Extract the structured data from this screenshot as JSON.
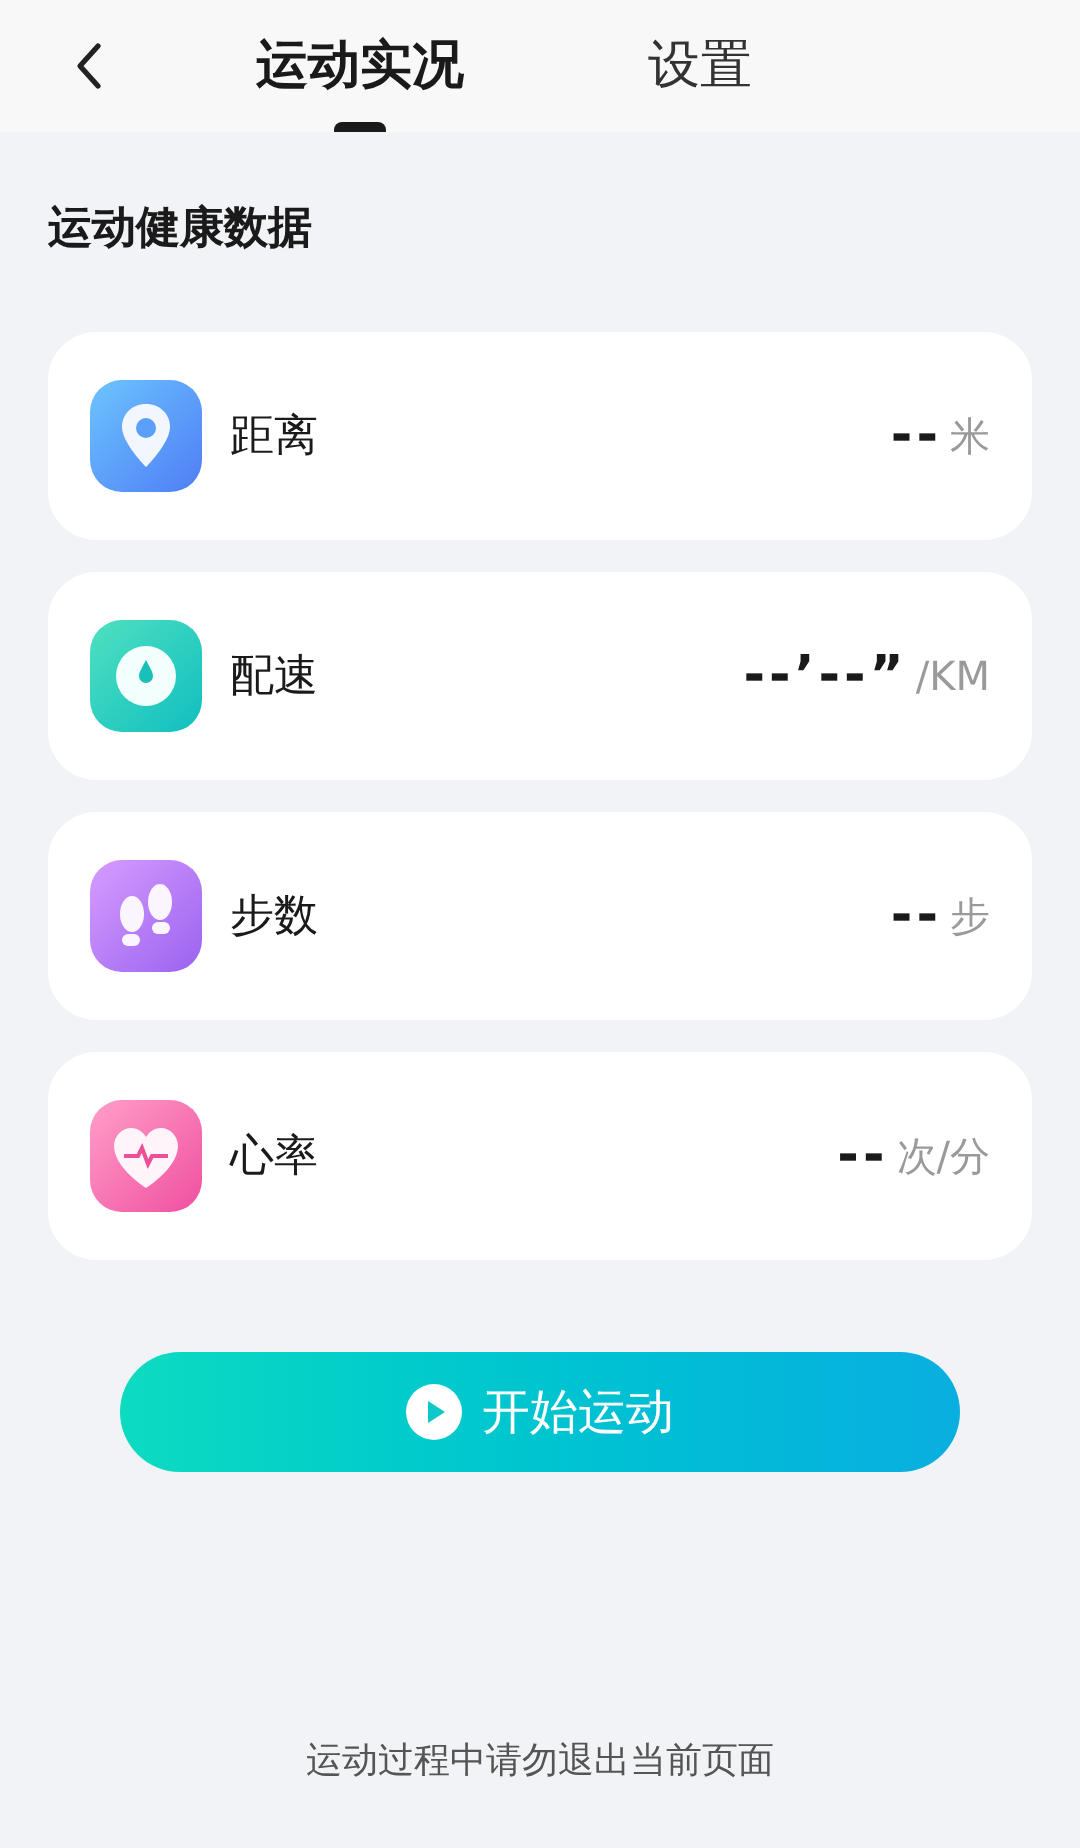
{
  "tabs": [
    {
      "label": "运动实况",
      "selected": true
    },
    {
      "label": "设置",
      "selected": false
    }
  ],
  "section_title": "运动健康数据",
  "metrics": [
    {
      "kind": "distance",
      "label": "距离",
      "value": "--",
      "unit": "米"
    },
    {
      "kind": "pace",
      "label": "配速",
      "value": "--’--”",
      "unit": "/KM"
    },
    {
      "kind": "steps",
      "label": "步数",
      "value": "--",
      "unit": "步"
    },
    {
      "kind": "heart",
      "label": "心率",
      "value": "--",
      "unit": "次/分"
    }
  ],
  "start_button": {
    "label": "开始运动"
  },
  "footer_note": "运动过程中请勿退出当前页面"
}
